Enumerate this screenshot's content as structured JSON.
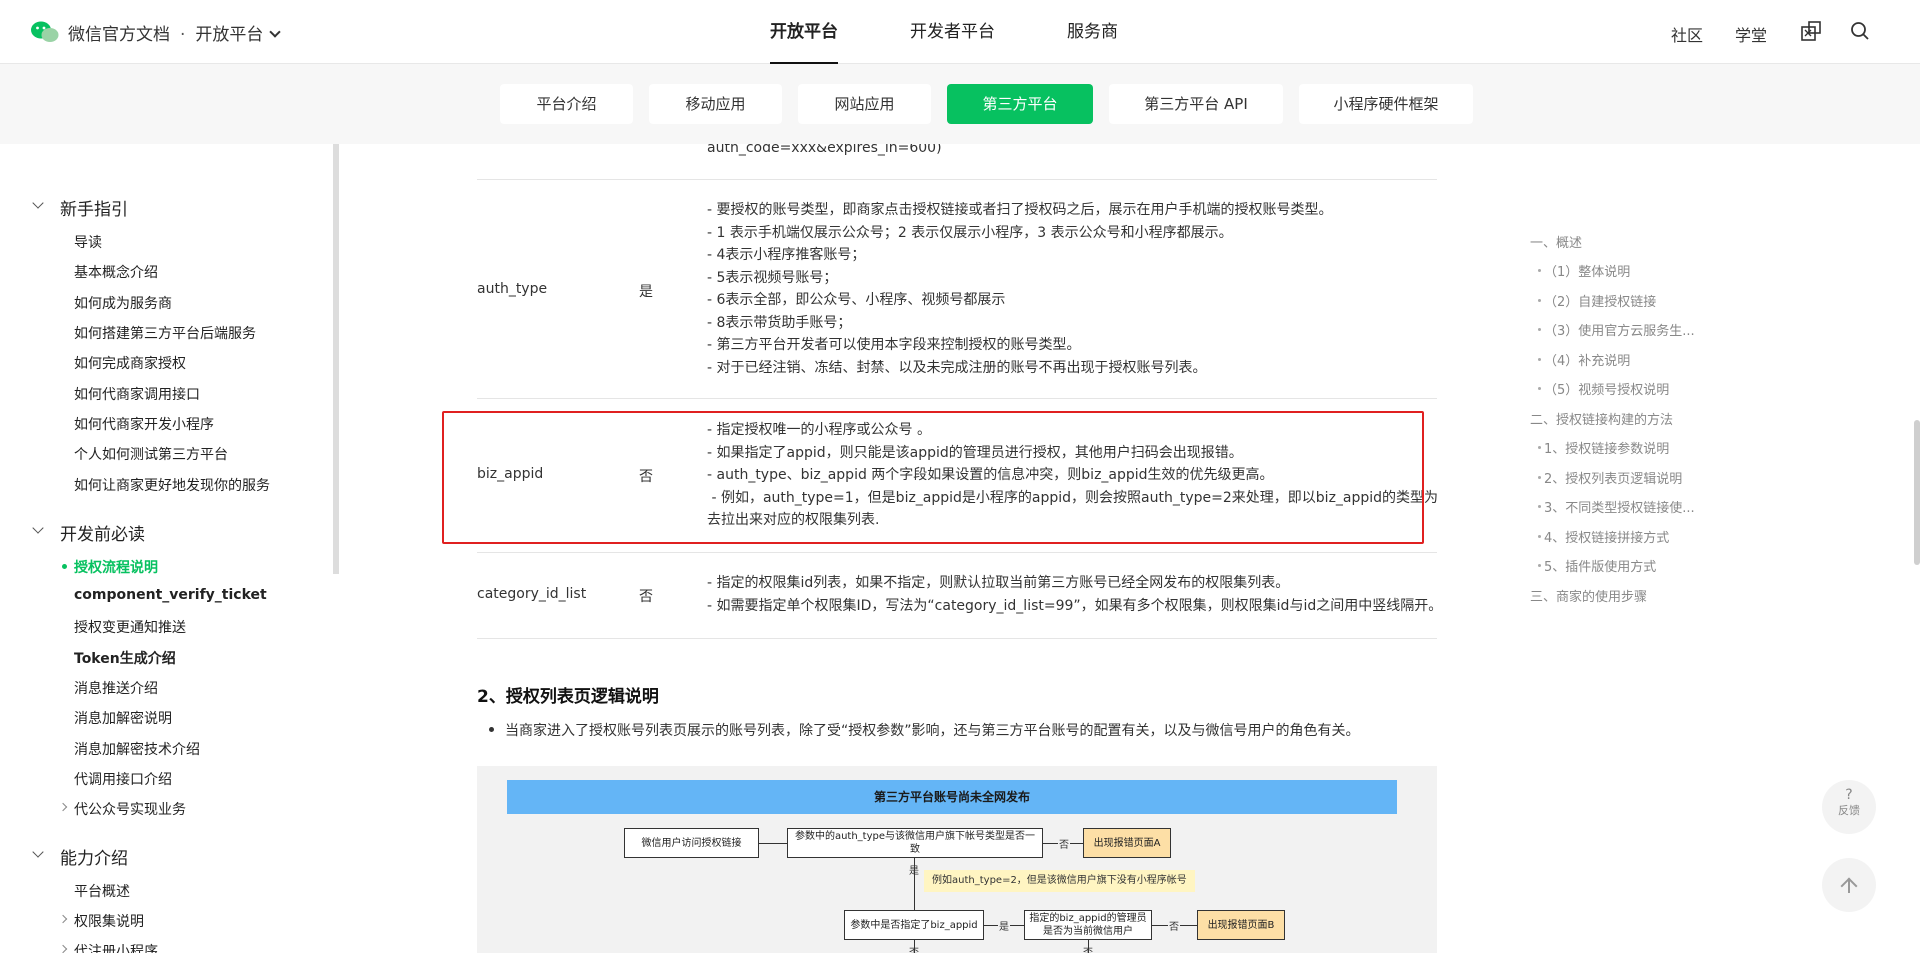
{
  "header": {
    "brand": "微信官方文档",
    "dot": "·",
    "platform": "开放平台",
    "nav": [
      "开放平台",
      "开发者平台",
      "服务商"
    ],
    "right_links": [
      "社区",
      "学堂"
    ]
  },
  "subnav": [
    "平台介绍",
    "移动应用",
    "网站应用",
    "第三方平台",
    "第三方平台 API",
    "小程序硬件框架"
  ],
  "sidebar": {
    "sections": [
      {
        "title": "新手指引",
        "items": [
          "导读",
          "基本概念介绍",
          "如何成为服务商",
          "如何搭建第三方平台后端服务",
          "如何完成商家授权",
          "如何代商家调用接口",
          "如何代商家开发小程序",
          "个人如何测试第三方平台",
          "如何让商家更好地发现你的服务"
        ]
      },
      {
        "title": "开发前必读",
        "items": [
          "授权流程说明",
          "component_verify_ticket",
          "授权变更通知推送",
          "Token生成介绍",
          "消息推送介绍",
          "消息加解密说明",
          "消息加解密技术介绍",
          "代调用接口介绍",
          "代公众号实现业务"
        ]
      },
      {
        "title": "能力介绍",
        "items": [
          "平台概述",
          "权限集说明",
          "代注册小程序"
        ]
      }
    ]
  },
  "table": {
    "top_fragment": "auth_code=xxx&expires_in=600)",
    "rows": [
      {
        "name": "auth_type",
        "required": "是",
        "lines": [
          "- 要授权的账号类型，即商家点击授权链接或者扫了授权码之后，展示在用户手机端的授权账号类型。",
          "- 1 表示手机端仅展示公众号；2 表示仅展示小程序，3 表示公众号和小程序都展示。",
          "- 4表示小程序推客账号；",
          "- 5表示视频号账号；",
          "- 6表示全部，即公众号、小程序、视频号都展示",
          "- 8表示带货助手账号；",
          "- 第三方平台开发者可以使用本字段来控制授权的账号类型。",
          "- 对于已经注销、冻结、封禁、以及未完成注册的账号不再出现于授权账号列表。"
        ]
      },
      {
        "name": "biz_appid",
        "required": "否",
        "lines": [
          "- 指定授权唯一的小程序或公众号 。",
          "- 如果指定了appid，则只能是该appid的管理员进行授权，其他用户扫码会出现报错。",
          "- auth_type、biz_appid 两个字段如果设置的信息冲突，则biz_appid生效的优先级更高。",
          " - 例如，auth_type=1，但是biz_appid是小程序的appid，则会按照auth_type=2来处理，即以biz_appid的类型为准",
          "去拉出来对应的权限集列表."
        ]
      },
      {
        "name": "category_id_list",
        "required": "否",
        "lines": [
          "- 指定的权限集id列表，如果不指定，则默认拉取当前第三方账号已经全网发布的权限集列表。",
          "- 如需要指定单个权限集ID，写法为“category_id_list=99”，如果有多个权限集，则权限集id与id之间用中竖线隔开。"
        ]
      }
    ]
  },
  "section2": {
    "heading": "2、授权列表页逻辑说明",
    "bullet": "当商家进入了授权账号列表页展示的账号列表，除了受“授权参数”影响，还与第三方平台账号的配置有关，以及与微信号用户的角色有关。"
  },
  "diagram": {
    "title": "第三方平台账号尚未全网发布",
    "box_user": "微信用户访问授权链接",
    "box_q1": "参数中的auth_type与该微信用户旗下帐号类型是否一致",
    "no1": "否",
    "err_a": "出现报错页面A",
    "yes1": "是",
    "note": "例如auth_type=2，但是该微信用户旗下没有小程序帐号",
    "box_q2": "参数中是否指定了biz_appid",
    "yes2": "是",
    "box_q3": "指定的biz_appid的管理员是否为当前微信用户",
    "no3": "否",
    "err_b": "出现报错页面B",
    "no2": "否",
    "no4": "否"
  },
  "toc": [
    {
      "text": "一、概述",
      "level": 1
    },
    {
      "text": "（1）整体说明",
      "level": 2
    },
    {
      "text": "（2）自建授权链接",
      "level": 2
    },
    {
      "text": "（3）使用官方云服务生...",
      "level": 2
    },
    {
      "text": "（4）补充说明",
      "level": 2
    },
    {
      "text": "（5）视频号授权说明",
      "level": 2
    },
    {
      "text": "二、授权链接构建的方法",
      "level": 1
    },
    {
      "text": "1、授权链接参数说明",
      "level": 2
    },
    {
      "text": "2、授权列表页逻辑说明",
      "level": 2
    },
    {
      "text": "3、不同类型授权链接使...",
      "level": 2
    },
    {
      "text": "4、授权链接拼接方式",
      "level": 2
    },
    {
      "text": "5、插件版使用方式",
      "level": 2
    },
    {
      "text": "三、商家的使用步骤",
      "level": 1
    }
  ],
  "fab": {
    "feedback_q": "?",
    "feedback_label": "反馈"
  }
}
